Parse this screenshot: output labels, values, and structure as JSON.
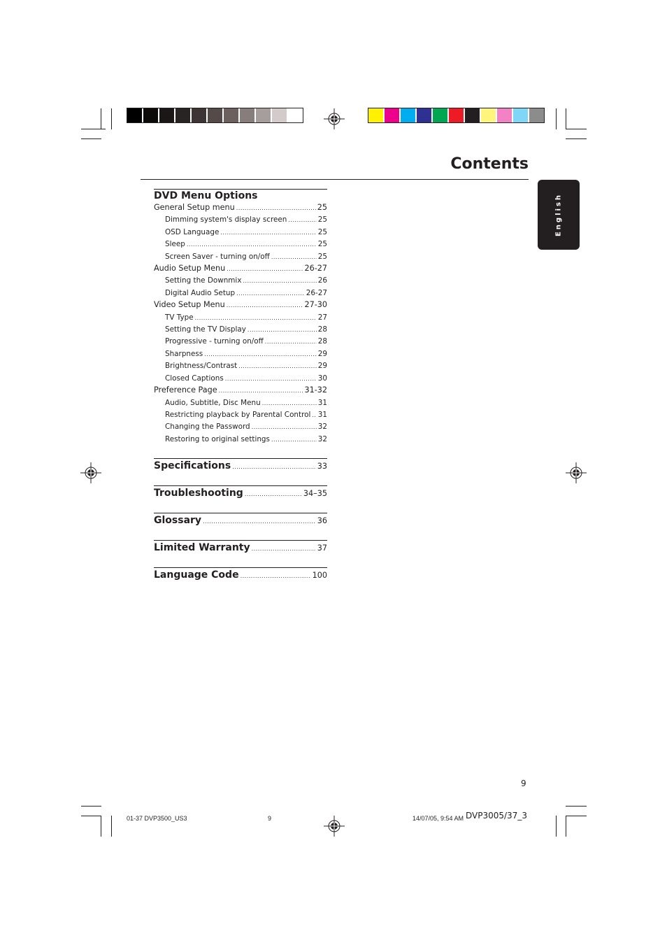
{
  "page": {
    "title": "Contents",
    "language_tab": "English",
    "page_number": "9"
  },
  "toc": {
    "dvd_menu_options": {
      "heading": "DVD Menu Options",
      "entries": [
        {
          "label": "General Setup menu",
          "page": "25",
          "level": 1
        },
        {
          "label": "Dimming system's display screen",
          "page": "25",
          "level": 2
        },
        {
          "label": "OSD Language",
          "page": "25",
          "level": 2
        },
        {
          "label": "Sleep",
          "page": "25",
          "level": 2
        },
        {
          "label": "Screen Saver - turning on/off",
          "page": "25",
          "level": 2
        },
        {
          "label": "Audio Setup Menu",
          "page": "26-27",
          "level": 1
        },
        {
          "label": "Setting the Downmix",
          "page": "26",
          "level": 2
        },
        {
          "label": "Digital Audio Setup",
          "page": "26-27",
          "level": 2
        },
        {
          "label": "Video Setup Menu",
          "page": "27-30",
          "level": 1
        },
        {
          "label": "TV Type",
          "page": "27",
          "level": 2
        },
        {
          "label": "Setting the TV Display",
          "page": "28",
          "level": 2
        },
        {
          "label": "Progressive - turning on/off",
          "page": "28",
          "level": 2
        },
        {
          "label": "Sharpness",
          "page": "29",
          "level": 2
        },
        {
          "label": "Brightness/Contrast",
          "page": "29",
          "level": 2
        },
        {
          "label": "Closed Captions",
          "page": "30",
          "level": 2
        },
        {
          "label": "Preference Page",
          "page": "31-32",
          "level": 1
        },
        {
          "label": "Audio, Subtitle, Disc Menu",
          "page": "31",
          "level": 2
        },
        {
          "label": "Restricting playback by Parental Control",
          "page": "31",
          "level": 2
        },
        {
          "label": "Changing the Password",
          "page": "32",
          "level": 2
        },
        {
          "label": "Restoring to original settings",
          "page": "32",
          "level": 2
        }
      ]
    },
    "sections": [
      {
        "label": "Specifications",
        "page": "33"
      },
      {
        "label": "Troubleshooting",
        "page": "34–35"
      },
      {
        "label": "Glossary",
        "page": "36"
      },
      {
        "label": "Limited Warranty",
        "page": "37"
      },
      {
        "label": "Language Code",
        "page": "100"
      }
    ]
  },
  "print_marks": {
    "grayscale_bar": [
      "#000000",
      "#0d0b0a",
      "#1a1716",
      "#282423",
      "#3d3534",
      "#544b49",
      "#6b605e",
      "#877d7b",
      "#a69e9c",
      "#d3cbc9",
      "#ffffff"
    ],
    "color_bar": [
      "#fff100",
      "#ec008c",
      "#00aeef",
      "#2e3192",
      "#00a651",
      "#ed1c24",
      "#231f20",
      "#fff57d",
      "#f282c4",
      "#7fd6f7",
      "#8c8c8c"
    ],
    "slug_file": "01-37 DVP3500_US3",
    "slug_page": "9",
    "slug_datetime": "14/07/05, 9:54 AM",
    "model_code": "DVP3005/37_3"
  }
}
